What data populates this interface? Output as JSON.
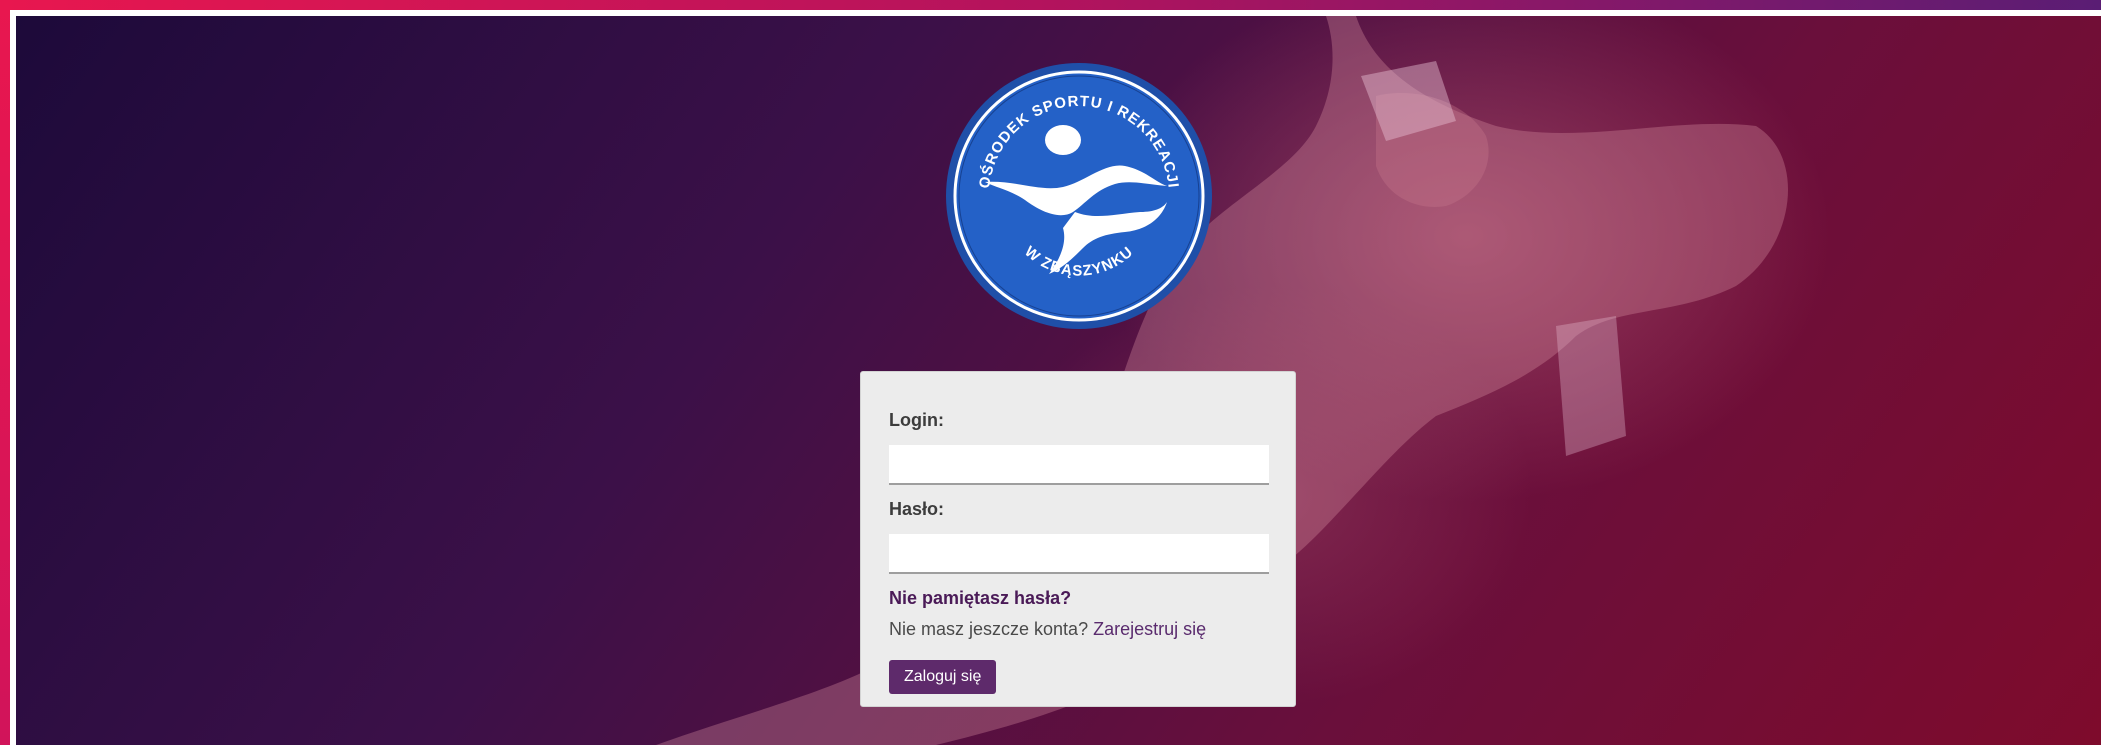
{
  "logo": {
    "top_text": "OŚRODEK SPORTU I REKREACJI",
    "bottom_text": "W ZBĄSZYNKU",
    "colors": {
      "outer": "#1f4fa8",
      "inner": "#2461c7",
      "ring": "#ffffff"
    }
  },
  "form": {
    "login_label": "Login:",
    "login_value": "",
    "password_label": "Hasło:",
    "password_value": "",
    "forgot_link": "Nie pamiętasz hasła?",
    "no_account_text": "Nie masz jeszcze konta?",
    "register_link": "Zarejestruj się",
    "submit_label": "Zaloguj się"
  },
  "theme": {
    "frame_accent": "#e8174f",
    "button_bg": "#5e2a6b",
    "link_color": "#4a1a57"
  }
}
